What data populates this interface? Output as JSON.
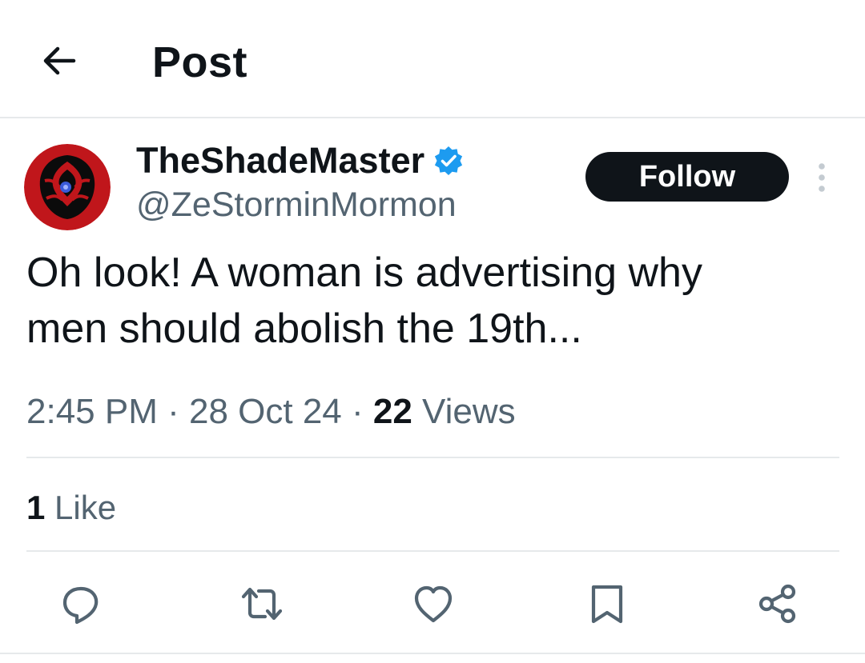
{
  "header": {
    "title": "Post",
    "back_icon": "arrow-left-icon"
  },
  "author": {
    "display_name": "TheShadeMaster",
    "handle": "@ZeStorminMormon",
    "verified": true,
    "verified_color": "#1d9bf0",
    "avatar_colors": [
      "#c0161b",
      "#0b0b0b",
      "#3a5bd9"
    ]
  },
  "follow_button": {
    "label": "Follow"
  },
  "tweet": {
    "text_line1": "Oh look! A woman is advertising why",
    "text_line2": "men should abolish the 19th..."
  },
  "meta": {
    "time": "2:45 PM",
    "sep1": " · ",
    "date": "28 Oct 24",
    "sep2": " · ",
    "views_count": "22",
    "views_label": " Views"
  },
  "engagement": {
    "likes_count": "1",
    "likes_label": " Like"
  },
  "actions": [
    {
      "icon": "reply-icon"
    },
    {
      "icon": "repost-icon"
    },
    {
      "icon": "like-icon"
    },
    {
      "icon": "bookmark-icon"
    },
    {
      "icon": "share-icon"
    }
  ],
  "colors": {
    "text_primary": "#0f1419",
    "text_secondary": "#536471",
    "divider": "#e6e9eb",
    "follow_bg": "#0f1419"
  }
}
